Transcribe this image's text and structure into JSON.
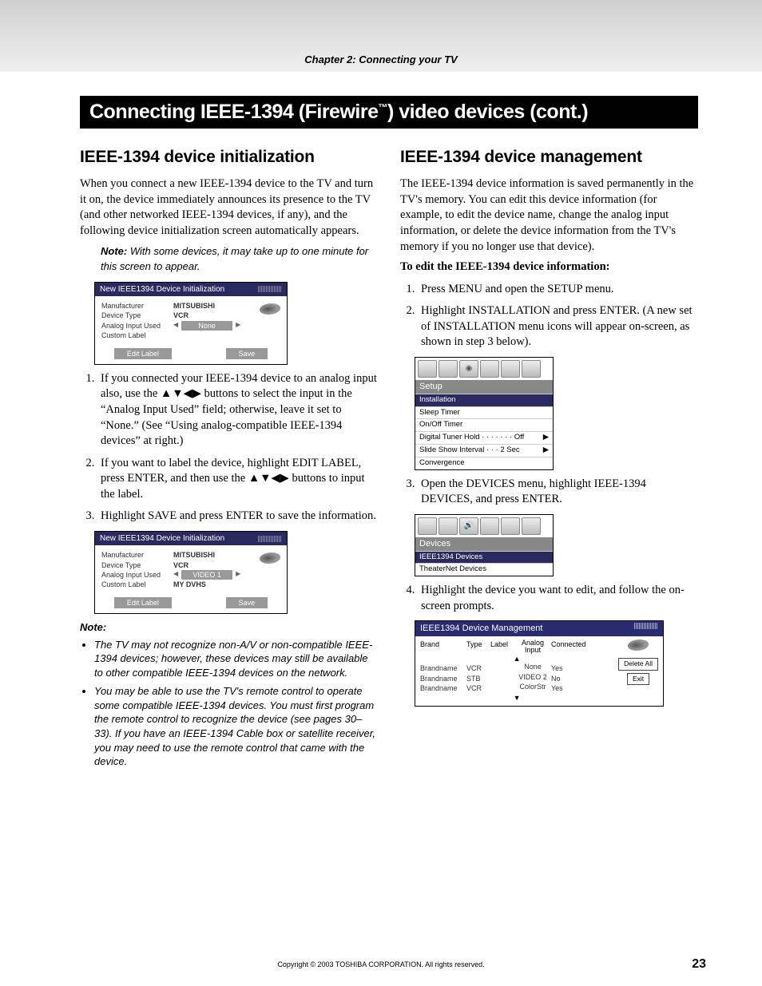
{
  "chapter": "Chapter 2: Connecting your TV",
  "page_title_a": "Connecting IEEE-1394 (Firewire",
  "page_title_tm": "™",
  "page_title_b": ") video devices (cont.)",
  "left": {
    "heading": "IEEE-1394 device initialization",
    "intro": "When you connect a new IEEE-1394 device to the TV and turn it on, the device immediately announces its presence to the TV (and other networked IEEE-1394 devices, if any), and the following device initialization screen automatically appears.",
    "note_lead": "Note:",
    "note_body": " With some devices, it may take up to one minute for this screen to appear.",
    "shot1": {
      "title": "New IEEE1394 Device Initialization",
      "rows": [
        {
          "k": "Manufacturer",
          "v": "MITSUBISHI"
        },
        {
          "k": "Device Type",
          "v": "VCR"
        },
        {
          "k": "Analog Input Used",
          "v": "None",
          "pill": true
        },
        {
          "k": "Custom Label",
          "v": ""
        }
      ],
      "btn1": "Edit Label",
      "btn2": "Save"
    },
    "steps": [
      "If you connected your IEEE-1394 device to an analog input also, use the ▲▼◀▶ buttons to select the input in the “Analog Input Used” field; otherwise, leave it set to “None.” (See “Using analog-compatible IEEE-1394 devices” at right.)",
      "If you want to label the device, highlight EDIT LABEL, press ENTER, and then use the ▲▼◀▶ buttons to input the label.",
      "Highlight SAVE and press ENTER to save the information."
    ],
    "shot2": {
      "title": "New IEEE1394 Device Initialization",
      "rows": [
        {
          "k": "Manufacturer",
          "v": "MITSUBISHI"
        },
        {
          "k": "Device Type",
          "v": "VCR"
        },
        {
          "k": "Analog Input Used",
          "v": "VIDEO 1",
          "pill": true
        },
        {
          "k": "Custom Label",
          "v": "MY DVHS"
        }
      ],
      "btn1": "Edit Label",
      "btn2": "Save"
    },
    "note2_lead": "Note:",
    "note2_items": [
      "The TV may not recognize non-A/V or non-compatible IEEE-1394 devices; however, these devices may still be available to other compatible IEEE-1394 devices on the network.",
      "You may be able to use the TV's remote control to operate some compatible IEEE-1394 devices. You must first program the remote control to recognize the device (see pages 30–33). If you have an IEEE-1394 Cable box or satellite receiver, you may need to use the remote control that came with the device."
    ]
  },
  "right": {
    "heading": "IEEE-1394 device management",
    "intro": "The IEEE-1394 device information is saved permanently in the TV's memory. You can edit this device information (for example, to edit the device name, change the analog input information, or delete the device information from the TV's memory if you no longer use that device).",
    "sub": "To edit the IEEE-1394 device information:",
    "steps12": [
      "Press MENU and open the SETUP menu.",
      "Highlight INSTALLATION and press ENTER. (A new set of INSTALLATION menu icons will appear on-screen, as shown in step 3 below)."
    ],
    "setup_menu": {
      "title": "Setup",
      "items": [
        {
          "t": "Installation",
          "sel": true
        },
        {
          "t": "Sleep Timer"
        },
        {
          "t": "On/Off Timer"
        },
        {
          "t": "Digital Tuner Hold · · · · · · · Off",
          "arrow": true
        },
        {
          "t": "Slide Show Interval · · · 2 Sec",
          "arrow": true
        },
        {
          "t": "Convergence"
        }
      ]
    },
    "step3": "Open the DEVICES menu, highlight IEEE-1394 DEVICES, and press ENTER.",
    "devices_menu": {
      "title": "Devices",
      "items": [
        {
          "t": "IEEE1394 Devices",
          "sel": true
        },
        {
          "t": "TheaterNet Devices"
        }
      ]
    },
    "step4": "Highlight the device you want to edit, and follow the on-screen prompts.",
    "mgmt": {
      "title": "IEEE1394 Device Management",
      "headers": [
        "Brand",
        "Type",
        "Label",
        "Analog\nInput",
        "Connected"
      ],
      "rows": [
        [
          "Brandname",
          "VCR",
          "",
          "None",
          "Yes"
        ],
        [
          "Brandname",
          "STB",
          "",
          "VIDEO 2",
          "No"
        ],
        [
          "Brandname",
          "VCR",
          "",
          "ColorStr",
          "Yes"
        ]
      ],
      "btns": [
        "Delete All",
        "Exit"
      ]
    }
  },
  "footer": "Copyright © 2003 TOSHIBA CORPORATION. All rights reserved.",
  "page_num": "23"
}
